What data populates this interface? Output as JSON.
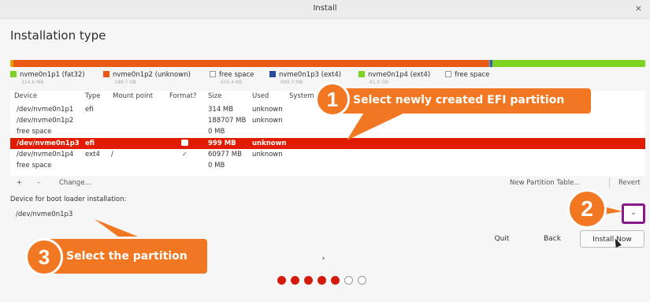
{
  "window": {
    "title": "Install",
    "close_glyph": "×"
  },
  "page_title": "Installation type",
  "disk_segments": [
    {
      "name": "nvme0n1p1",
      "color": "#e6a000",
      "fraction": 0.005
    },
    {
      "name": "nvme0n1p2",
      "color": "#e95a16",
      "fraction": 0.748
    },
    {
      "name": "free",
      "color": "#8a8a8a",
      "fraction": 0.002
    },
    {
      "name": "nvme0n1p3",
      "color": "#3a5fa6",
      "fraction": 0.004
    },
    {
      "name": "nvme0n1p4",
      "color": "#7ed321",
      "fraction": 0.241
    }
  ],
  "legend": [
    {
      "label": "nvme0n1p1 (fat32)",
      "size": "314.6 MB",
      "color": "#7ed321",
      "outline": false
    },
    {
      "label": "nvme0n1p2 (unknown)",
      "size": "188.7 GB",
      "color": "#e95a16",
      "outline": false
    },
    {
      "label": "free space",
      "size": "655.4 KB",
      "color": "#ffffff",
      "outline": true
    },
    {
      "label": "nvme0n1p3 (ext4)",
      "size": "999.3 MB",
      "color": "#2b4a9a",
      "outline": false
    },
    {
      "label": "nvme0n1p4 (ext4)",
      "size": "61.0 GB",
      "color": "#7ed321",
      "outline": false
    },
    {
      "label": "free space",
      "size": "",
      "color": "#ffffff",
      "outline": true
    }
  ],
  "table": {
    "headers": [
      "Device",
      "Type",
      "Mount point",
      "Format?",
      "Size",
      "Used",
      "System"
    ],
    "rows": [
      {
        "device": "/dev/nvme0n1p1",
        "type": "efi",
        "mount": "",
        "format": "",
        "size": "314 MB",
        "used": "unknown"
      },
      {
        "device": "/dev/nvme0n1p2",
        "type": "",
        "mount": "",
        "format": "",
        "size": "188707 MB",
        "used": "unknown"
      },
      {
        "device": "free space",
        "type": "",
        "mount": "",
        "format": "",
        "size": "0 MB",
        "used": ""
      },
      {
        "device": "/dev/nvme0n1p3",
        "type": "efi",
        "mount": "",
        "format": "box",
        "size": "999 MB",
        "used": "unknown",
        "selected": true
      },
      {
        "device": "/dev/nvme0n1p4",
        "type": "ext4",
        "mount": "/",
        "format": "check",
        "size": "60977 MB",
        "used": "unknown"
      },
      {
        "device": "free space",
        "type": "",
        "mount": "",
        "format": "",
        "size": "0 MB",
        "used": ""
      }
    ]
  },
  "toolbar": {
    "add": "+",
    "remove": "–",
    "change": "Change...",
    "new_table": "New Partition Table...",
    "revert": "Revert"
  },
  "bootloader": {
    "label": "Device for boot loader installation:",
    "value": "/dev/nvme0n1p3",
    "dropdown_glyph": "⌄"
  },
  "buttons": {
    "quit": "Quit",
    "back": "Back",
    "install": "Install Now"
  },
  "steps": {
    "total": 7,
    "done": 5
  },
  "annotations": [
    {
      "number": "1",
      "text": "Select newly created EFI partition"
    },
    {
      "number": "2",
      "text": ""
    },
    {
      "number": "3",
      "text": "Select the partition"
    }
  ],
  "colors": {
    "accent": "#e01b00",
    "callout": "#f27722",
    "highlight": "#8a1a8a"
  }
}
